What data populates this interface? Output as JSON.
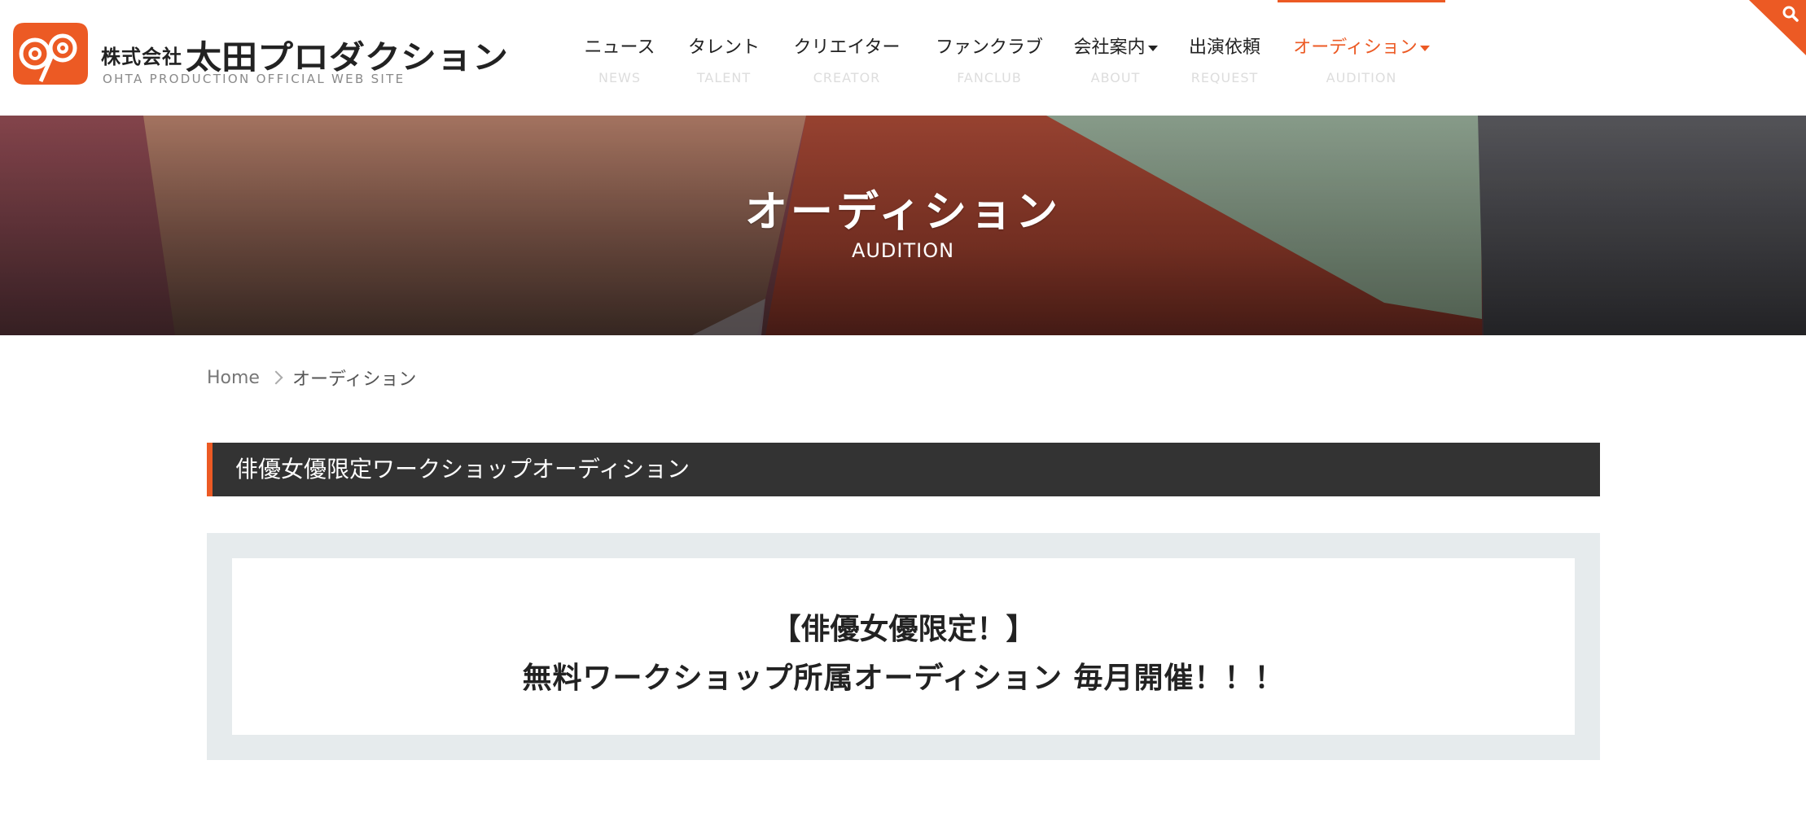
{
  "header": {
    "logo": {
      "company_prefix": "株式会社",
      "company_name": "太田プロダクション",
      "subtitle": "OHTA PRODUCTION OFFICIAL WEB SITE",
      "mark_letters": "OP"
    },
    "nav": [
      {
        "jp": "ニュース",
        "en": "NEWS",
        "has_dropdown": false,
        "active": false
      },
      {
        "jp": "タレント",
        "en": "TALENT",
        "has_dropdown": false,
        "active": false
      },
      {
        "jp": "クリエイター",
        "en": "CREATOR",
        "has_dropdown": false,
        "active": false
      },
      {
        "jp": "ファンクラブ",
        "en": "FANCLUB",
        "has_dropdown": false,
        "active": false
      },
      {
        "jp": "会社案内",
        "en": "ABOUT",
        "has_dropdown": true,
        "active": false
      },
      {
        "jp": "出演依頼",
        "en": "REQUEST",
        "has_dropdown": false,
        "active": false
      },
      {
        "jp": "オーディション",
        "en": "AUDITION",
        "has_dropdown": true,
        "active": true
      }
    ],
    "search_icon": "search-icon"
  },
  "hero": {
    "title": "オーディション",
    "subtitle": "AUDITION"
  },
  "breadcrumb": {
    "home": "Home",
    "current": "オーディション"
  },
  "section": {
    "heading": "俳優女優限定ワークショップオーディション"
  },
  "announcement": {
    "line1": "【俳優女優限定！】",
    "line2": "無料ワークショップ所属オーディション 毎月開催！！！"
  },
  "colors": {
    "accent": "#ec5a24",
    "heading_bg": "#333333",
    "box_bg": "#e6ebed"
  }
}
